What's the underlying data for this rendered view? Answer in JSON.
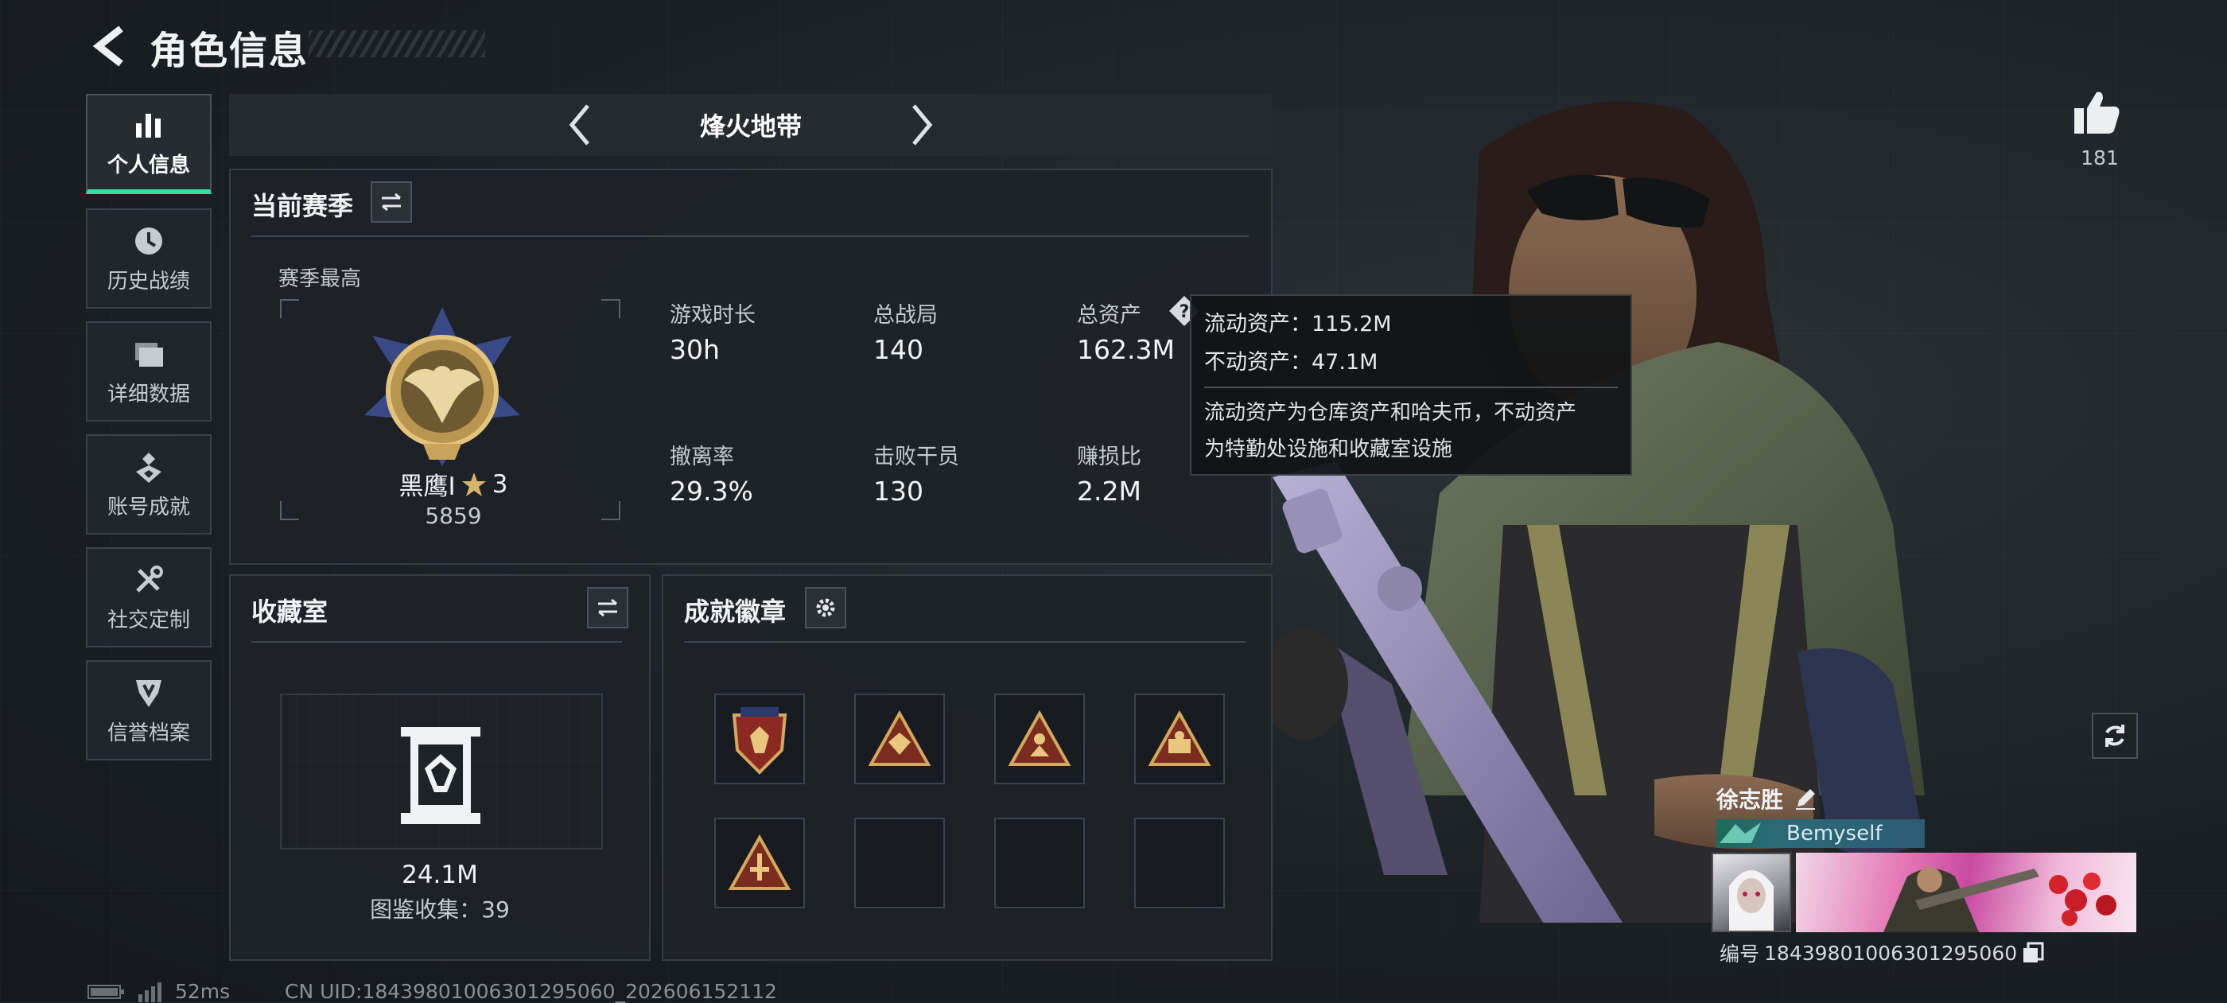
{
  "header": {
    "title": "角色信息"
  },
  "sidebar": {
    "items": [
      {
        "label": "个人信息",
        "icon": "bar-chart-icon",
        "active": true
      },
      {
        "label": "历史战绩",
        "icon": "clock-icon"
      },
      {
        "label": "详细数据",
        "icon": "folder-icon"
      },
      {
        "label": "账号成就",
        "icon": "achievement-icon"
      },
      {
        "label": "社交定制",
        "icon": "tools-icon"
      },
      {
        "label": "信誉档案",
        "icon": "emblem-icon"
      }
    ]
  },
  "mode_selector": {
    "current": "烽火地带"
  },
  "season": {
    "title": "当前赛季",
    "best_label": "赛季最高",
    "rank_name": "黑鹰I",
    "rank_stars": "3",
    "rank_score": "5859",
    "stats": [
      {
        "label": "游戏时长",
        "value": "30h"
      },
      {
        "label": "总战局",
        "value": "140"
      },
      {
        "label": "总资产",
        "value": "162.3M"
      },
      {
        "label": "撤离率",
        "value": "29.3%"
      },
      {
        "label": "击败干员",
        "value": "130"
      },
      {
        "label": "赚损比",
        "value": "2.2M"
      }
    ]
  },
  "tooltip": {
    "liquid": "流动资产：115.2M",
    "fixed": "不动资产：47.1M",
    "desc_line1": "流动资产为仓库资产和哈夫币，不动资产",
    "desc_line2": "为特勤处设施和收藏室设施"
  },
  "collection": {
    "title": "收藏室",
    "value": "24.1M",
    "count": "图鉴收集：39"
  },
  "badges": {
    "title": "成就徽章",
    "filled": 5,
    "total": 8
  },
  "likes": {
    "count": "181"
  },
  "player": {
    "name": "徐志胜",
    "tag": "Bemyself",
    "id_label": "编号",
    "id": "1843980100630129506​0"
  },
  "footer": {
    "ping": "52ms",
    "uid": "CN UID:1843980100630129506​0_202606152112"
  },
  "colors": {
    "accent": "#2fe0a0",
    "gold": "#c9a35a",
    "background": "#1b2025"
  }
}
